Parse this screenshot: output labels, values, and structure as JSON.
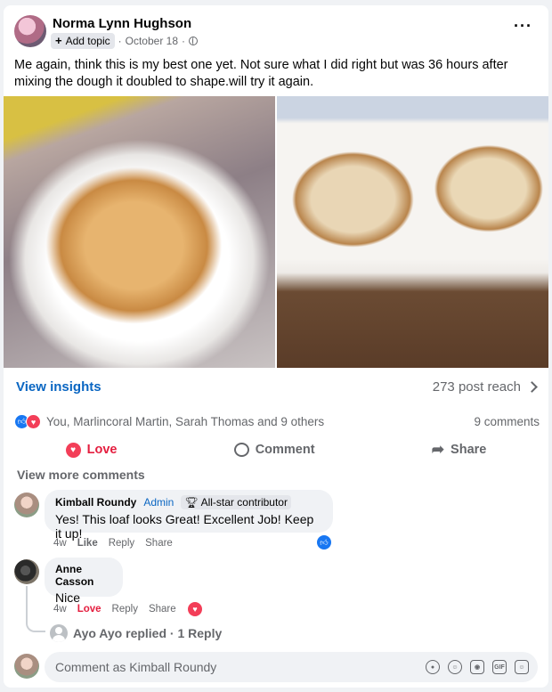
{
  "post": {
    "author": "Norma Lynn Hughson",
    "add_topic": "Add topic",
    "date": "October 18",
    "text": "Me again, think this is my best one yet. Not sure what I did right but was 36 hours after mixing the dough it doubled to shape.will try it again."
  },
  "insights": {
    "label": "View insights",
    "reach": "273 post reach"
  },
  "reactions": {
    "summary": "You, Marlincoral Martin, Sarah Thomas and 9 others",
    "comments_count": "9 comments"
  },
  "actions": {
    "love": "Love",
    "comment": "Comment",
    "share": "Share"
  },
  "comments_section": {
    "view_more": "View more comments",
    "comments": [
      {
        "name": "Kimball Roundy",
        "role": "Admin",
        "badge": "All-star contributor",
        "text": "Yes! This loaf looks Great! Excellent Job! Keep it up!",
        "time": "4w",
        "reaction_action": "Like",
        "reply": "Reply",
        "share": "Share"
      },
      {
        "name": "Anne Casson",
        "text": "Nice",
        "time": "4w",
        "reaction_action": "Love",
        "reply": "Reply",
        "share": "Share",
        "replies_summary": "Ayo Ayo replied · 1 Reply"
      }
    ]
  },
  "composer": {
    "placeholder": "Comment as Kimball Roundy"
  },
  "icons": [
    "more-options-icon",
    "globe-icon",
    "like-reaction-icon",
    "love-reaction-icon",
    "comment-icon",
    "share-icon",
    "emoji-icon",
    "camera-icon",
    "gif-icon",
    "sticker-icon",
    "avatar-sticker-icon",
    "trophy-icon",
    "chevron-right-icon"
  ],
  "colors": {
    "accent_blue": "#0a66c2",
    "like_blue": "#1877f2",
    "love_red": "#e41e3f",
    "muted_text": "#65676b"
  }
}
